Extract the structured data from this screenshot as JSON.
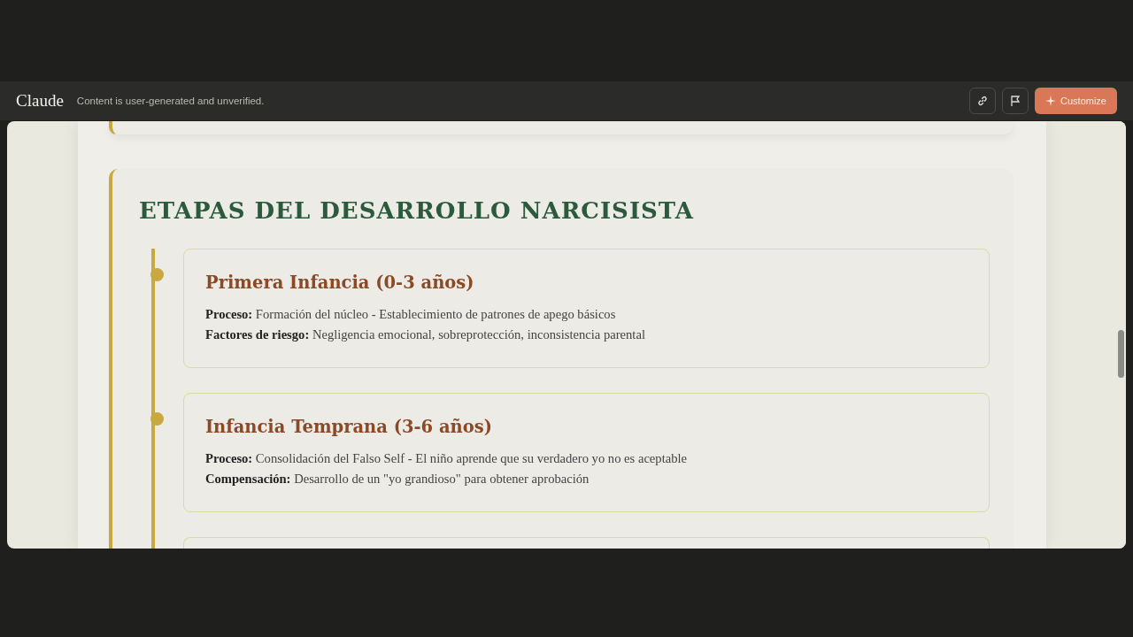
{
  "header": {
    "app_name": "Claude",
    "notice": "Content is user-generated and unverified.",
    "customize_button": "Customize"
  },
  "section": {
    "title": "ETAPAS DEL DESARROLLO NARCISISTA",
    "stages": [
      {
        "title": "Primera Infancia (0-3 años)",
        "lines": [
          "**Proceso:** Formación del núcleo - Establecimiento de patrones de apego básicos",
          "**Factores de riesgo:** Negligencia emocional, sobreprotección, inconsistencia parental"
        ]
      },
      {
        "title": "Infancia Temprana (3-6 años)",
        "lines": [
          "**Proceso:** Consolidación del Falso Self - El niño aprende que su verdadero yo no es aceptable",
          "**Compensación:** Desarrollo de un \"yo grandioso\" para obtener aprobación"
        ]
      }
    ]
  }
}
